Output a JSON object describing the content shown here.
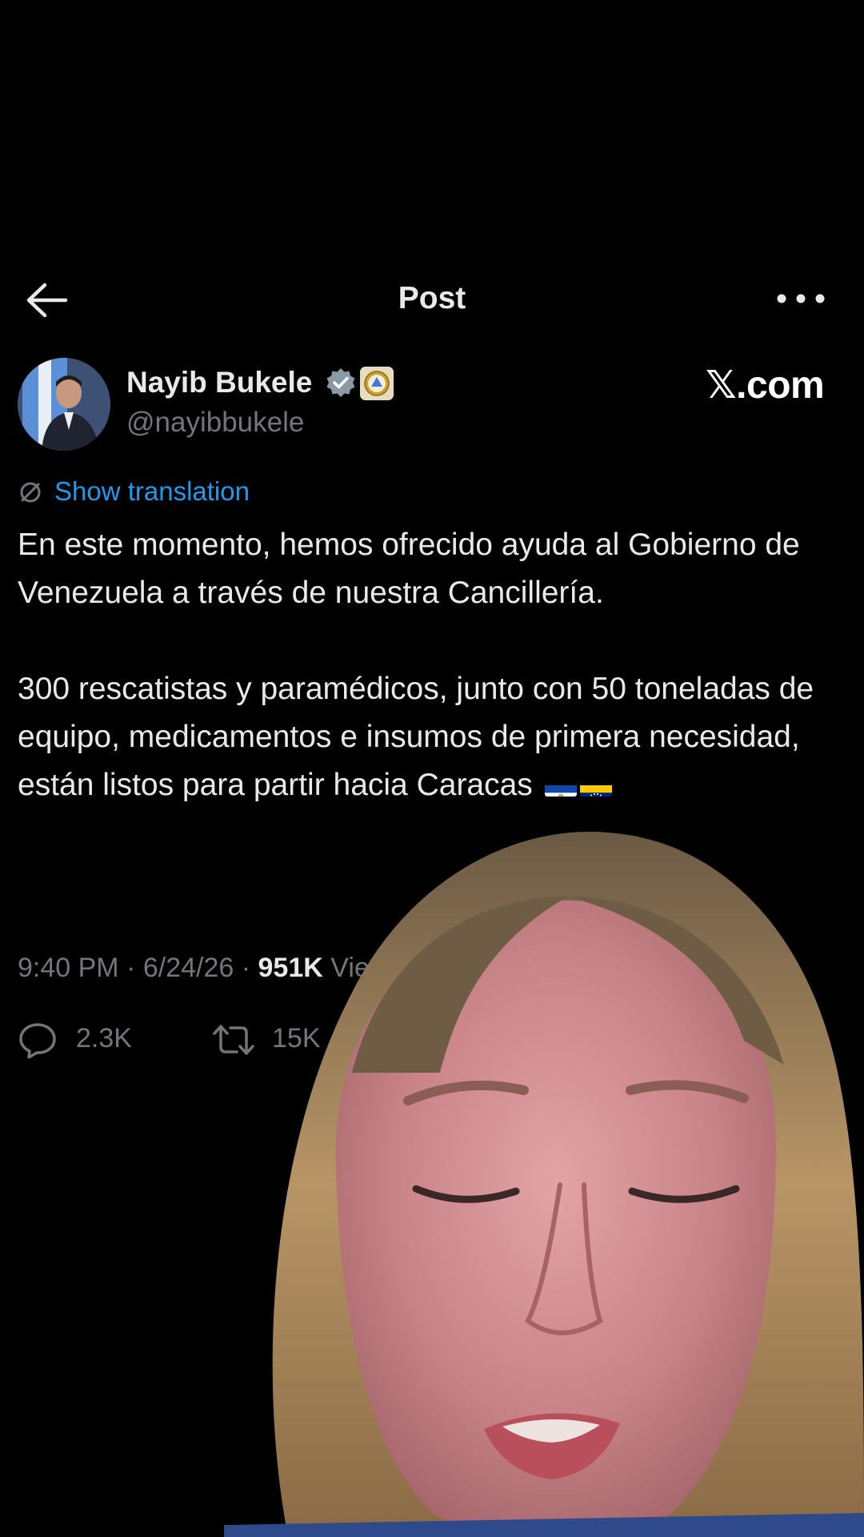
{
  "header": {
    "title": "Post",
    "back_icon": "arrow-left-icon",
    "more_icon": "more-horizontal-icon"
  },
  "author": {
    "name": "Nayib Bukele",
    "handle": "@nayibbukele",
    "verified": true,
    "verified_color": "#8b98a5"
  },
  "watermark": "𝕏.com",
  "translation": {
    "label": "Show translation",
    "icon": "translate-icon",
    "color": "#1d9bf0"
  },
  "tweet": {
    "paragraph_1": "En este momento, hemos ofrecido ayuda al Gobierno de Venezuela a través de nuestra Cancillería.",
    "paragraph_2": "300 rescatistas y paramédicos, junto con 50 toneladas de equipo, medicamentos e insumos de primera necesidad, están listos para partir hacia Caracas",
    "flags": [
      "el-salvador-flag",
      "venezuela-flag"
    ]
  },
  "meta": {
    "time": "9:40 PM",
    "date": "6/24/26",
    "views_count": "951K",
    "views_label": "Vie"
  },
  "stats": {
    "replies": "2.3K",
    "reposts": "15K"
  },
  "theme": {
    "background": "#000000",
    "text": "#e7e9ea",
    "secondary": "#71767b"
  }
}
